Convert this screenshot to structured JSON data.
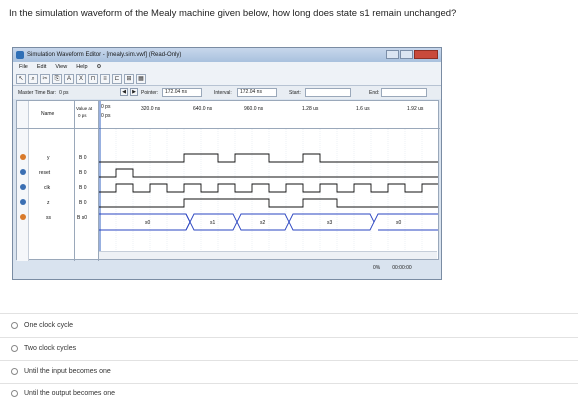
{
  "question": "In the simulation waveform of the Mealy machine given below, how long does state s1 remain unchanged?",
  "window": {
    "title": "Simulation Waveform Editor - [mealy.sim.vwf] (Read-Only)",
    "menu": [
      "File",
      "Edit",
      "View",
      "Help"
    ],
    "toolbar_icons": [
      "select-icon",
      "zoom-icon",
      "cut-icon",
      "copy-icon",
      "paste-icon",
      "x-icon",
      "wave-icon",
      "count-icon",
      "clock-icon",
      "grid-icon",
      "chart-icon"
    ]
  },
  "timebar": {
    "master_label": "Master Time Bar:",
    "master_value": "0 ps",
    "pointer_label": "Pointer:",
    "pointer_value": "172.04 ns",
    "interval_label": "Interval:",
    "interval_value": "172.04 ns",
    "start_label": "Start:",
    "end_label": "End:"
  },
  "grid": {
    "name_header": "Name",
    "value_header_line1": "Value at",
    "value_header_line2": "0 ps",
    "cursor_label_top": "0 ps",
    "cursor_label_bot": "0 ps",
    "time_labels": [
      "320.0 ns",
      "640.0 ns",
      "960.0 ns",
      "1.28 us",
      "1.6 us",
      "1.92 us"
    ]
  },
  "signals": [
    {
      "name": "y",
      "value": "B 0",
      "type": "out"
    },
    {
      "name": "reset",
      "value": "B 0",
      "type": "in"
    },
    {
      "name": "clk",
      "value": "B 0",
      "type": "in"
    },
    {
      "name": "z",
      "value": "B 0",
      "type": "in"
    },
    {
      "name": "ss",
      "value": "B s0",
      "type": "out"
    }
  ],
  "state_labels": [
    "s0",
    "s1",
    "s2",
    "s3",
    "s0"
  ],
  "status": {
    "percent": "0%",
    "time": "00:00:00"
  },
  "options": [
    "One clock cycle",
    "Two clock cycles",
    "Until the input becomes one",
    "Until the output becomes one"
  ]
}
